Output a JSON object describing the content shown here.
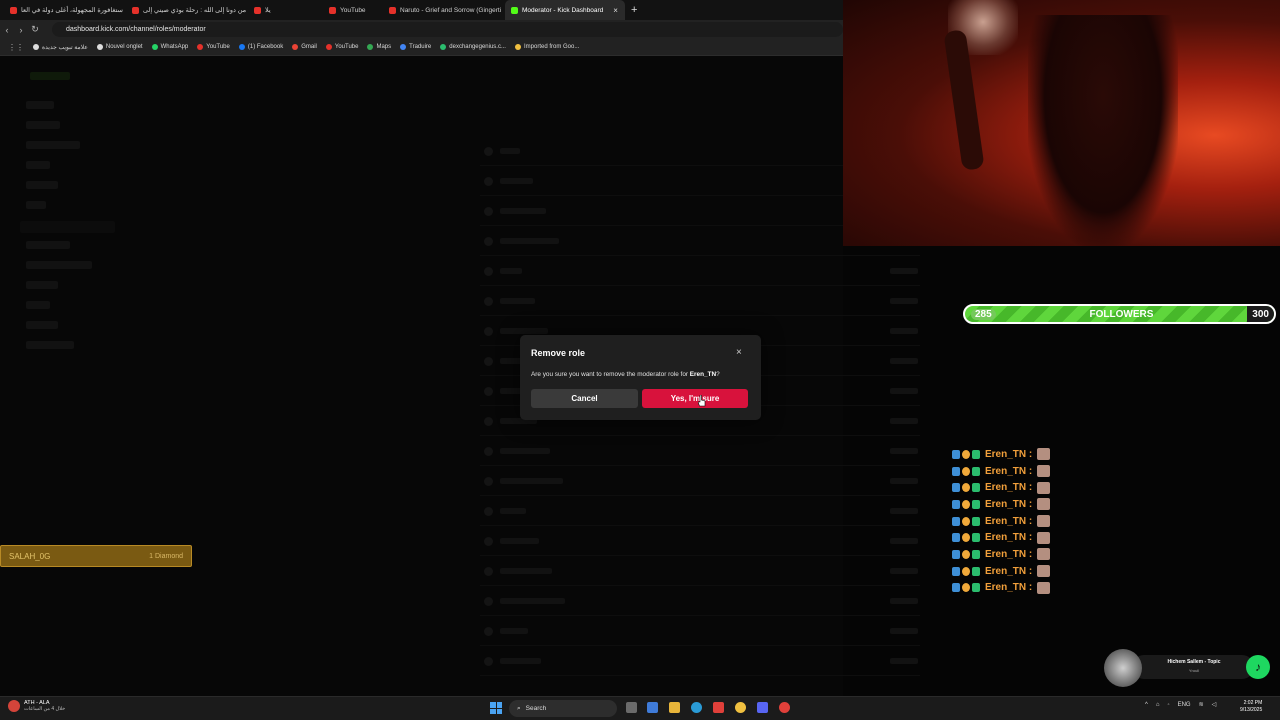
{
  "browser": {
    "tabs": [
      {
        "label": "ستغافورة المجهولة، أغلى دولة في العا",
        "favicon": "youtube-icon",
        "active": false
      },
      {
        "label": "من دونا إلى الله : رحلة بوذي صيني إلى",
        "favicon": "youtube-icon",
        "active": false
      },
      {
        "label": "يلا",
        "favicon": "youtube-icon",
        "active": false
      },
      {
        "label": "YouTube",
        "favicon": "youtube-icon",
        "active": false
      },
      {
        "label": "Naruto - Grief and Sorrow (Gingerti",
        "favicon": "youtube-icon",
        "active": false
      },
      {
        "label": "Moderator - Kick Dashboard",
        "favicon": "kick-icon",
        "active": true
      }
    ],
    "close_glyph": "×",
    "new_tab_glyph": "+",
    "url": "dashboard.kick.com/channel/roles/moderator",
    "bookmarks": [
      {
        "label": "علامة تبويب جديدة",
        "color": "#dddddd"
      },
      {
        "label": "Nouvel onglet",
        "color": "#dddddd"
      },
      {
        "label": "WhatsApp",
        "color": "#25d366"
      },
      {
        "label": "YouTube",
        "color": "#e5312a"
      },
      {
        "label": "(1) Facebook",
        "color": "#1877f2"
      },
      {
        "label": "Gmail",
        "color": "#ea4335"
      },
      {
        "label": "YouTube",
        "color": "#e5312a"
      },
      {
        "label": "Maps",
        "color": "#34a853"
      },
      {
        "label": "Traduire",
        "color": "#4285f4"
      },
      {
        "label": "dexchangegenius.c...",
        "color": "#2bbd6e"
      },
      {
        "label": "Imported from Goo...",
        "color": "#f0c040"
      }
    ]
  },
  "modal": {
    "title": "Remove role",
    "close_glyph": "×",
    "body_prefix": "Are you sure you want to remove the moderator role for ",
    "username": "Eren_TN",
    "body_suffix": "?",
    "cancel_label": "Cancel",
    "confirm_label": "Yes, I'm sure",
    "confirm_color": "#d8123c"
  },
  "followers_goal": {
    "current": "285",
    "label": "FOLLOWERS",
    "goal": "300",
    "progress": 0.95
  },
  "chat": {
    "messages": [
      {
        "name": "Eren_TN :"
      },
      {
        "name": "Eren_TN :"
      },
      {
        "name": "Eren_TN :"
      },
      {
        "name": "Eren_TN :"
      },
      {
        "name": "Eren_TN :"
      },
      {
        "name": "Eren_TN :"
      },
      {
        "name": "Eren_TN :"
      },
      {
        "name": "Eren_TN :"
      },
      {
        "name": "Eren_TN :"
      }
    ]
  },
  "alert": {
    "name": "SALAH_0G",
    "amount": "1 Diamond"
  },
  "music": {
    "title": "Hichem Sallem - Topic",
    "subtitle": "Yroull"
  },
  "taskbar": {
    "weather_line1": "ATH - ALA",
    "weather_line2": "خلال 4 من الساعات",
    "search_label": "Search",
    "language": "ENG",
    "time": "2:02 PM",
    "date": "9/13/2025"
  }
}
